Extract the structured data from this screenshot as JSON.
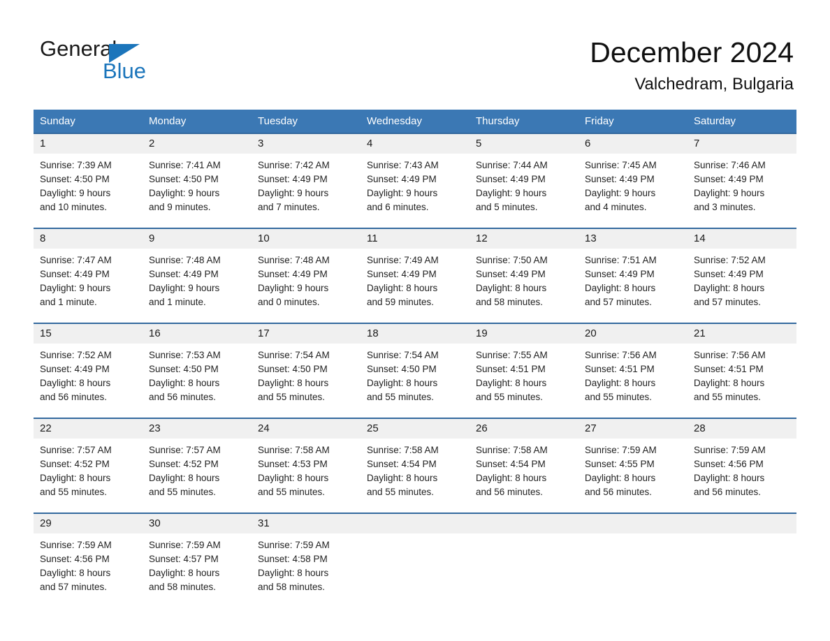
{
  "brand": {
    "name_part1": "General",
    "name_part2": "Blue",
    "logo_icon": "triangle-logo-icon"
  },
  "header": {
    "title": "December 2024",
    "subtitle": "Valchedram, Bulgaria"
  },
  "colors": {
    "header_blue": "#3b78b4",
    "row_divider_blue": "#33699e",
    "date_band_gray": "#f0f0f0",
    "brand_blue": "#1b75bb"
  },
  "weekdays": [
    "Sunday",
    "Monday",
    "Tuesday",
    "Wednesday",
    "Thursday",
    "Friday",
    "Saturday"
  ],
  "weeks": [
    {
      "days": [
        {
          "date": "1",
          "l1": "Sunrise: 7:39 AM",
          "l2": "Sunset: 4:50 PM",
          "l3": "Daylight: 9 hours",
          "l4": "and 10 minutes."
        },
        {
          "date": "2",
          "l1": "Sunrise: 7:41 AM",
          "l2": "Sunset: 4:50 PM",
          "l3": "Daylight: 9 hours",
          "l4": "and 9 minutes."
        },
        {
          "date": "3",
          "l1": "Sunrise: 7:42 AM",
          "l2": "Sunset: 4:49 PM",
          "l3": "Daylight: 9 hours",
          "l4": "and 7 minutes."
        },
        {
          "date": "4",
          "l1": "Sunrise: 7:43 AM",
          "l2": "Sunset: 4:49 PM",
          "l3": "Daylight: 9 hours",
          "l4": "and 6 minutes."
        },
        {
          "date": "5",
          "l1": "Sunrise: 7:44 AM",
          "l2": "Sunset: 4:49 PM",
          "l3": "Daylight: 9 hours",
          "l4": "and 5 minutes."
        },
        {
          "date": "6",
          "l1": "Sunrise: 7:45 AM",
          "l2": "Sunset: 4:49 PM",
          "l3": "Daylight: 9 hours",
          "l4": "and 4 minutes."
        },
        {
          "date": "7",
          "l1": "Sunrise: 7:46 AM",
          "l2": "Sunset: 4:49 PM",
          "l3": "Daylight: 9 hours",
          "l4": "and 3 minutes."
        }
      ]
    },
    {
      "days": [
        {
          "date": "8",
          "l1": "Sunrise: 7:47 AM",
          "l2": "Sunset: 4:49 PM",
          "l3": "Daylight: 9 hours",
          "l4": "and 1 minute."
        },
        {
          "date": "9",
          "l1": "Sunrise: 7:48 AM",
          "l2": "Sunset: 4:49 PM",
          "l3": "Daylight: 9 hours",
          "l4": "and 1 minute."
        },
        {
          "date": "10",
          "l1": "Sunrise: 7:48 AM",
          "l2": "Sunset: 4:49 PM",
          "l3": "Daylight: 9 hours",
          "l4": "and 0 minutes."
        },
        {
          "date": "11",
          "l1": "Sunrise: 7:49 AM",
          "l2": "Sunset: 4:49 PM",
          "l3": "Daylight: 8 hours",
          "l4": "and 59 minutes."
        },
        {
          "date": "12",
          "l1": "Sunrise: 7:50 AM",
          "l2": "Sunset: 4:49 PM",
          "l3": "Daylight: 8 hours",
          "l4": "and 58 minutes."
        },
        {
          "date": "13",
          "l1": "Sunrise: 7:51 AM",
          "l2": "Sunset: 4:49 PM",
          "l3": "Daylight: 8 hours",
          "l4": "and 57 minutes."
        },
        {
          "date": "14",
          "l1": "Sunrise: 7:52 AM",
          "l2": "Sunset: 4:49 PM",
          "l3": "Daylight: 8 hours",
          "l4": "and 57 minutes."
        }
      ]
    },
    {
      "days": [
        {
          "date": "15",
          "l1": "Sunrise: 7:52 AM",
          "l2": "Sunset: 4:49 PM",
          "l3": "Daylight: 8 hours",
          "l4": "and 56 minutes."
        },
        {
          "date": "16",
          "l1": "Sunrise: 7:53 AM",
          "l2": "Sunset: 4:50 PM",
          "l3": "Daylight: 8 hours",
          "l4": "and 56 minutes."
        },
        {
          "date": "17",
          "l1": "Sunrise: 7:54 AM",
          "l2": "Sunset: 4:50 PM",
          "l3": "Daylight: 8 hours",
          "l4": "and 55 minutes."
        },
        {
          "date": "18",
          "l1": "Sunrise: 7:54 AM",
          "l2": "Sunset: 4:50 PM",
          "l3": "Daylight: 8 hours",
          "l4": "and 55 minutes."
        },
        {
          "date": "19",
          "l1": "Sunrise: 7:55 AM",
          "l2": "Sunset: 4:51 PM",
          "l3": "Daylight: 8 hours",
          "l4": "and 55 minutes."
        },
        {
          "date": "20",
          "l1": "Sunrise: 7:56 AM",
          "l2": "Sunset: 4:51 PM",
          "l3": "Daylight: 8 hours",
          "l4": "and 55 minutes."
        },
        {
          "date": "21",
          "l1": "Sunrise: 7:56 AM",
          "l2": "Sunset: 4:51 PM",
          "l3": "Daylight: 8 hours",
          "l4": "and 55 minutes."
        }
      ]
    },
    {
      "days": [
        {
          "date": "22",
          "l1": "Sunrise: 7:57 AM",
          "l2": "Sunset: 4:52 PM",
          "l3": "Daylight: 8 hours",
          "l4": "and 55 minutes."
        },
        {
          "date": "23",
          "l1": "Sunrise: 7:57 AM",
          "l2": "Sunset: 4:52 PM",
          "l3": "Daylight: 8 hours",
          "l4": "and 55 minutes."
        },
        {
          "date": "24",
          "l1": "Sunrise: 7:58 AM",
          "l2": "Sunset: 4:53 PM",
          "l3": "Daylight: 8 hours",
          "l4": "and 55 minutes."
        },
        {
          "date": "25",
          "l1": "Sunrise: 7:58 AM",
          "l2": "Sunset: 4:54 PM",
          "l3": "Daylight: 8 hours",
          "l4": "and 55 minutes."
        },
        {
          "date": "26",
          "l1": "Sunrise: 7:58 AM",
          "l2": "Sunset: 4:54 PM",
          "l3": "Daylight: 8 hours",
          "l4": "and 56 minutes."
        },
        {
          "date": "27",
          "l1": "Sunrise: 7:59 AM",
          "l2": "Sunset: 4:55 PM",
          "l3": "Daylight: 8 hours",
          "l4": "and 56 minutes."
        },
        {
          "date": "28",
          "l1": "Sunrise: 7:59 AM",
          "l2": "Sunset: 4:56 PM",
          "l3": "Daylight: 8 hours",
          "l4": "and 56 minutes."
        }
      ]
    },
    {
      "days": [
        {
          "date": "29",
          "l1": "Sunrise: 7:59 AM",
          "l2": "Sunset: 4:56 PM",
          "l3": "Daylight: 8 hours",
          "l4": "and 57 minutes."
        },
        {
          "date": "30",
          "l1": "Sunrise: 7:59 AM",
          "l2": "Sunset: 4:57 PM",
          "l3": "Daylight: 8 hours",
          "l4": "and 58 minutes."
        },
        {
          "date": "31",
          "l1": "Sunrise: 7:59 AM",
          "l2": "Sunset: 4:58 PM",
          "l3": "Daylight: 8 hours",
          "l4": "and 58 minutes."
        },
        {
          "date": "",
          "l1": "",
          "l2": "",
          "l3": "",
          "l4": ""
        },
        {
          "date": "",
          "l1": "",
          "l2": "",
          "l3": "",
          "l4": ""
        },
        {
          "date": "",
          "l1": "",
          "l2": "",
          "l3": "",
          "l4": ""
        },
        {
          "date": "",
          "l1": "",
          "l2": "",
          "l3": "",
          "l4": ""
        }
      ]
    }
  ]
}
